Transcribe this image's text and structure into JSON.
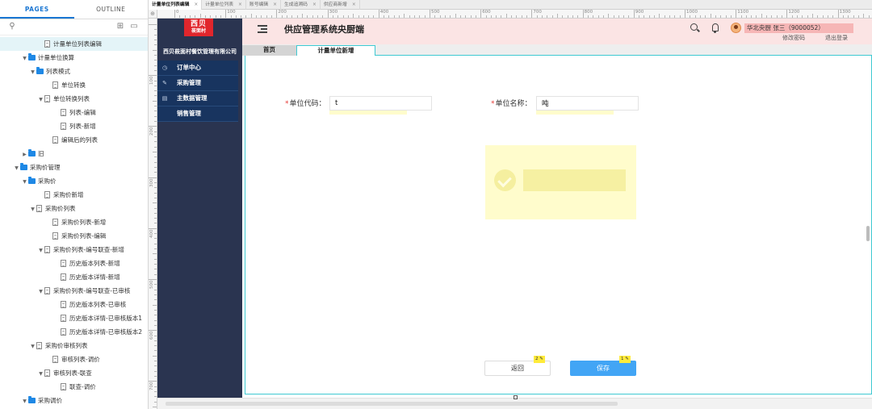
{
  "panel": {
    "tabs": [
      "PAGES",
      "OUTLINE"
    ],
    "tree": [
      {
        "label": "计量单位列表编辑",
        "type": "page",
        "depth": 4,
        "arrow": "",
        "selected": true
      },
      {
        "label": "计量单位换算",
        "type": "folder",
        "depth": 2,
        "arrow": "▼"
      },
      {
        "label": "列表模式",
        "type": "folder",
        "depth": 3,
        "arrow": "▼"
      },
      {
        "label": "单位转换",
        "type": "page",
        "depth": 5,
        "arrow": ""
      },
      {
        "label": "单位转换列表",
        "type": "page",
        "depth": 4,
        "arrow": "▼"
      },
      {
        "label": "列表-编辑",
        "type": "page",
        "depth": 6,
        "arrow": ""
      },
      {
        "label": "列表-新增",
        "type": "page",
        "depth": 6,
        "arrow": ""
      },
      {
        "label": "编辑后的列表",
        "type": "page",
        "depth": 5,
        "arrow": ""
      },
      {
        "label": "旧",
        "type": "folder",
        "depth": 2,
        "arrow": "▶"
      },
      {
        "label": "采购价管理",
        "type": "folder",
        "depth": 1,
        "arrow": "▼"
      },
      {
        "label": "采购价",
        "type": "folder",
        "depth": 2,
        "arrow": "▼"
      },
      {
        "label": "采购价新增",
        "type": "page",
        "depth": 4,
        "arrow": ""
      },
      {
        "label": "采购价列表",
        "type": "page",
        "depth": 3,
        "arrow": "▼"
      },
      {
        "label": "采购价列表-新增",
        "type": "page",
        "depth": 5,
        "arrow": ""
      },
      {
        "label": "采购价列表-编辑",
        "type": "page",
        "depth": 5,
        "arrow": ""
      },
      {
        "label": "采购价列表-编号联查-新增",
        "type": "page",
        "depth": 4,
        "arrow": "▼"
      },
      {
        "label": "历史版本列表-新增",
        "type": "page",
        "depth": 6,
        "arrow": ""
      },
      {
        "label": "历史版本详情-新增",
        "type": "page",
        "depth": 6,
        "arrow": ""
      },
      {
        "label": "采购价列表-编号联查-已审核",
        "type": "page",
        "depth": 4,
        "arrow": "▼"
      },
      {
        "label": "历史版本列表-已审核",
        "type": "page",
        "depth": 6,
        "arrow": ""
      },
      {
        "label": "历史版本详情-已审核版本1",
        "type": "page",
        "depth": 6,
        "arrow": ""
      },
      {
        "label": "历史版本详情-已审核版本2",
        "type": "page",
        "depth": 6,
        "arrow": ""
      },
      {
        "label": "采购价审核列表",
        "type": "page",
        "depth": 3,
        "arrow": "▼"
      },
      {
        "label": "审核列表-调价",
        "type": "page",
        "depth": 5,
        "arrow": ""
      },
      {
        "label": "审核列表-联查",
        "type": "page",
        "depth": 4,
        "arrow": "▼"
      },
      {
        "label": "联查-调价",
        "type": "page",
        "depth": 6,
        "arrow": ""
      },
      {
        "label": "采购调价",
        "type": "folder",
        "depth": 2,
        "arrow": "▼"
      }
    ]
  },
  "doc_tabs": [
    {
      "label": "计量单位列表编辑",
      "active": true
    },
    {
      "label": "计量单位列表",
      "active": false
    },
    {
      "label": "账号编辑",
      "active": false
    },
    {
      "label": "生成追溯码",
      "active": false
    },
    {
      "label": "供应商新增",
      "active": false
    }
  ],
  "ruler": {
    "h_labels": [
      "0",
      "100",
      "200",
      "300",
      "400",
      "500",
      "600",
      "700",
      "800",
      "900",
      "1000",
      "1100",
      "1200",
      "1300"
    ],
    "v_labels": [
      "100",
      "200",
      "300",
      "400",
      "500",
      "600",
      "700"
    ]
  },
  "app": {
    "logo_top": "西贝",
    "logo_bottom": "莜面村",
    "company": "西贝莜面村餐饮管理有限公司",
    "menu": [
      {
        "icon": "◷",
        "label": "订单中心"
      },
      {
        "icon": "✎",
        "label": "采购管理"
      },
      {
        "icon": "▤",
        "label": "主数据管理"
      },
      {
        "icon": "",
        "label": "销售管理"
      }
    ],
    "title": "供应管理系统央厨端",
    "user": "华北央厨 张三（9000052）",
    "change_password": "修改密码",
    "logout": "退出登录",
    "tabs": {
      "home": "首页",
      "current": "计量单位新增"
    },
    "form": {
      "code_label": "单位代码：",
      "code_value": "t",
      "name_label": "单位名称：",
      "name_value": "吨",
      "required_mark": "*"
    },
    "buttons": {
      "back": "返回",
      "save": "保存"
    },
    "badges": {
      "back": "2 ✎",
      "save": "1 ✎"
    }
  },
  "colors": {
    "sidebar": "#2a3450",
    "menu": "#18345f",
    "header": "#fbe4e4",
    "accent": "#3fc9d2",
    "primary": "#42a5f5",
    "required": "#e53935"
  }
}
